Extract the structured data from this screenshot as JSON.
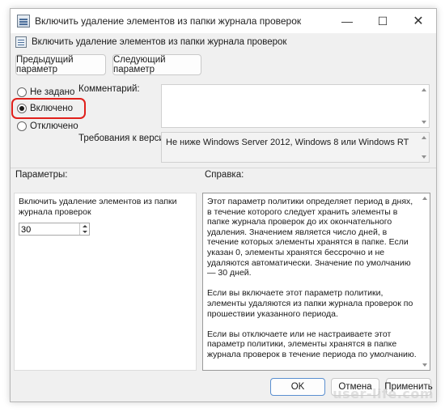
{
  "window": {
    "title": "Включить удаление элементов из папки журнала проверок",
    "controls": {
      "minimize": "—",
      "maximize": "☐",
      "close": "✕"
    }
  },
  "header": {
    "policy_name": "Включить удаление элементов из папки журнала проверок",
    "prev_button": "Предыдущий параметр",
    "next_button": "Следующий параметр"
  },
  "state": {
    "options": [
      {
        "label": "Не задано",
        "selected": false
      },
      {
        "label": "Включено",
        "selected": true
      },
      {
        "label": "Отключено",
        "selected": false
      }
    ]
  },
  "comment": {
    "label": "Комментарий:",
    "value": ""
  },
  "requirements": {
    "label": "Требования к версии:",
    "value": "Не ниже Windows Server 2012, Windows 8 или Windows RT"
  },
  "parameters": {
    "label": "Параметры:",
    "setting_label": "Включить удаление элементов из папки журнала проверок",
    "setting_value": "30"
  },
  "help": {
    "label": "Справка:",
    "paragraphs": [
      "Этот параметр политики определяет период в днях, в течение которого следует хранить элементы в папке журнала проверок до их окончательного удаления. Значением является число дней, в течение которых элементы хранятся в папке. Если указан 0, элементы хранятся бессрочно и не удаляются автоматически. Значение по умолчанию — 30 дней.",
      "Если вы включаете этот параметр политики, элементы удаляются из папки журнала проверок по прошествии указанного периода.",
      "Если вы отключаете или не настраиваете этот параметр политики, элементы хранятся в папке журнала проверок в течение периода по умолчанию."
    ]
  },
  "footer": {
    "ok": "OK",
    "cancel": "Отмена",
    "apply": "Применить"
  },
  "watermark": "user-life.com",
  "colors": {
    "highlight": "#e0201b",
    "dialog_bg": "#f0f0f0"
  }
}
